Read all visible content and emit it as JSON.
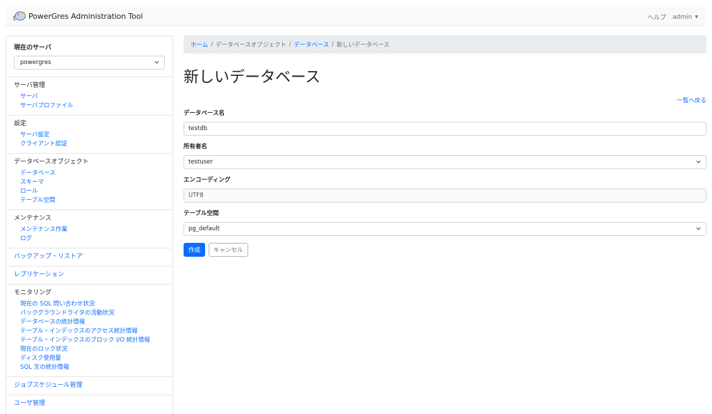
{
  "navbar": {
    "brand": "PowerGres Administration Tool",
    "help": "ヘルプ",
    "user": "admin"
  },
  "sidebar": {
    "current_server_label": "現在のサーバ",
    "current_server_value": "powergres",
    "sections": [
      {
        "title": "サーバ管理",
        "items": [
          "サーバ",
          "サーバプロファイル"
        ]
      },
      {
        "title": "設定",
        "items": [
          "サーバ設定",
          "クライアント認証"
        ]
      },
      {
        "title": "データベースオブジェクト",
        "items": [
          "データベース",
          "スキーマ",
          "ロール",
          "テーブル空間"
        ]
      },
      {
        "title": "メンテナンス",
        "items": [
          "メンテナンス作業",
          "ログ"
        ]
      },
      {
        "title": "バックアップ・リストア",
        "items": []
      },
      {
        "title": "レプリケーション",
        "items": []
      },
      {
        "title": "モニタリング",
        "items": [
          "現在の SQL 問い合わせ状況",
          "バックグラウンドライタの活動状況",
          "データベースの統計情報",
          "テーブル・インデックスのアクセス統計情報",
          "テーブル・インデックスのブロック I/O 統計情報",
          "現在のロック状況",
          "ディスク使用量",
          "SQL 文の統計情報"
        ]
      },
      {
        "title": "ジョブスケジュール管理",
        "items": []
      },
      {
        "title": "ユーザ管理",
        "items": []
      }
    ]
  },
  "breadcrumb": {
    "home": "ホーム",
    "db_objects": "データベースオブジェクト",
    "databases": "データベース",
    "current": "新しいデータベース"
  },
  "page": {
    "title": "新しいデータベース",
    "back_link": "一覧へ戻る"
  },
  "form": {
    "db_name_label": "データベース名",
    "db_name_value": "testdb",
    "owner_label": "所有者名",
    "owner_value": "testuser",
    "encoding_label": "エンコーディング",
    "encoding_value": "UTF8",
    "tablespace_label": "テーブル空間",
    "tablespace_value": "pg_default",
    "create_button": "作成",
    "cancel_button": "キャンセル"
  }
}
